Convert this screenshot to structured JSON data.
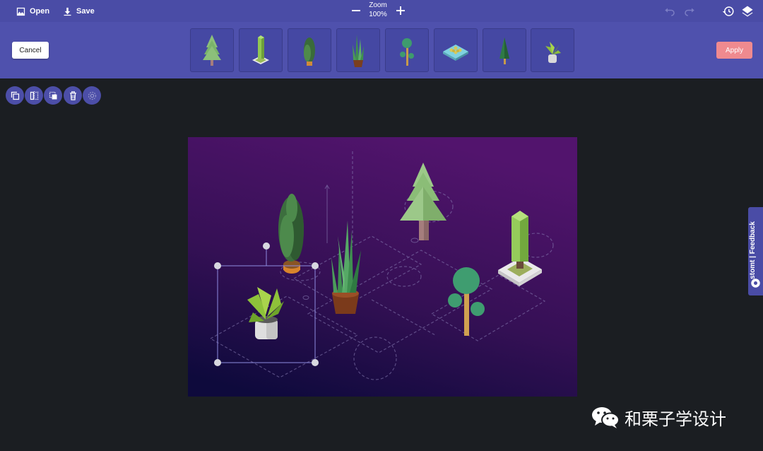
{
  "toolbar": {
    "open_label": "Open",
    "save_label": "Save",
    "zoom_label": "Zoom",
    "zoom_value": "100%",
    "icons": [
      "image-icon",
      "download-icon",
      "minus-icon",
      "plus-icon",
      "undo-icon",
      "redo-icon",
      "history-icon",
      "layers-icon"
    ]
  },
  "asset_bar": {
    "cancel_label": "Cancel",
    "apply_label": "Apply",
    "assets": [
      "pine-tree",
      "cypress-column",
      "tall-shrub",
      "potted-snake-plant",
      "round-tree",
      "flower-bed",
      "small-pine",
      "potted-plant"
    ]
  },
  "object_tools": [
    "duplicate-icon",
    "flip-icon",
    "send-backward-icon",
    "trash-icon",
    "settings-icon"
  ],
  "feedback": {
    "label": "stomt | Feedback"
  },
  "watermark": {
    "text": "和栗子学设计"
  },
  "colors": {
    "topbar": "#4a4ca6",
    "assetbar": "#4f51ad",
    "background": "#1b1e22",
    "apply": "#ef8a8f",
    "canvas_top": "#4e1468",
    "canvas_bottom": "#120b3e"
  }
}
